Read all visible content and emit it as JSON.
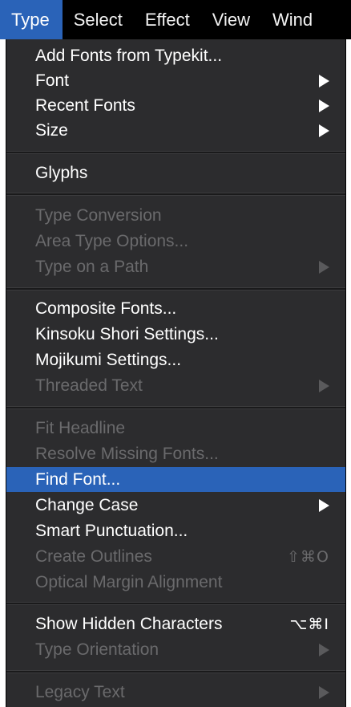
{
  "menubar": {
    "items": [
      {
        "label": "Type"
      },
      {
        "label": "Select"
      },
      {
        "label": "Effect"
      },
      {
        "label": "View"
      },
      {
        "label": "Wind"
      }
    ],
    "active_index": 0
  },
  "menu": {
    "items": [
      {
        "label": "Add Fonts from Typekit..."
      },
      {
        "label": "Font",
        "submenu": true
      },
      {
        "label": "Recent Fonts",
        "submenu": true
      },
      {
        "label": "Size",
        "submenu": true
      },
      {
        "label": "Glyphs"
      },
      {
        "label": "Type Conversion",
        "disabled": true
      },
      {
        "label": "Area Type Options...",
        "disabled": true
      },
      {
        "label": "Type on a Path",
        "disabled": true,
        "submenu": true
      },
      {
        "label": "Composite Fonts..."
      },
      {
        "label": "Kinsoku Shori Settings..."
      },
      {
        "label": "Mojikumi Settings..."
      },
      {
        "label": "Threaded Text",
        "disabled": true,
        "submenu": true
      },
      {
        "label": "Fit Headline",
        "disabled": true
      },
      {
        "label": "Resolve Missing Fonts...",
        "disabled": true
      },
      {
        "label": "Find Font...",
        "highlighted": true
      },
      {
        "label": "Change Case",
        "submenu": true
      },
      {
        "label": "Smart Punctuation..."
      },
      {
        "label": "Create Outlines",
        "disabled": true,
        "shortcut": "⇧⌘O"
      },
      {
        "label": "Optical Margin Alignment",
        "disabled": true
      },
      {
        "label": "Show Hidden Characters",
        "shortcut": "⌥⌘I"
      },
      {
        "label": "Type Orientation",
        "disabled": true,
        "submenu": true
      },
      {
        "label": "Legacy Text",
        "disabled": true,
        "submenu": true
      }
    ]
  },
  "colors": {
    "menubar_bg": "#000000",
    "menu_bg": "#2c2c2e",
    "highlight": "#2a63b8",
    "text": "#ffffff",
    "disabled_text": "#6a6a6c"
  }
}
